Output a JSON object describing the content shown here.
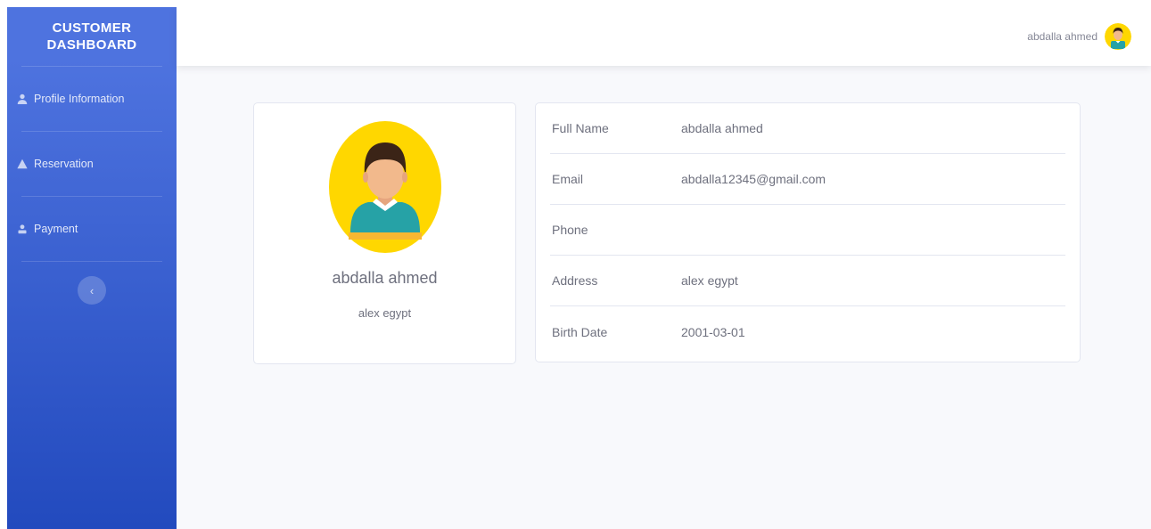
{
  "sidebar": {
    "brand": "CUSTOMER DASHBOARD",
    "items": [
      {
        "label": "Profile Information",
        "icon": "user-icon"
      },
      {
        "label": "Reservation",
        "icon": "warning-icon"
      },
      {
        "label": "Payment",
        "icon": "id-badge-icon"
      }
    ],
    "toggle_icon": "chevron-left-icon",
    "gradient": [
      "#4e73df",
      "#224abe"
    ]
  },
  "topbar": {
    "user_name": "abdalla ahmed",
    "avatar_icon": "user-avatar-icon"
  },
  "profile": {
    "name": "abdalla ahmed",
    "location": "alex egypt",
    "avatar_bg": "#ffd700"
  },
  "details": [
    {
      "label": "Full Name",
      "value": "abdalla ahmed"
    },
    {
      "label": "Email",
      "value": "abdalla12345@gmail.com"
    },
    {
      "label": "Phone",
      "value": ""
    },
    {
      "label": "Address",
      "value": "alex egypt"
    },
    {
      "label": "Birth Date",
      "value": "2001-03-01"
    }
  ]
}
